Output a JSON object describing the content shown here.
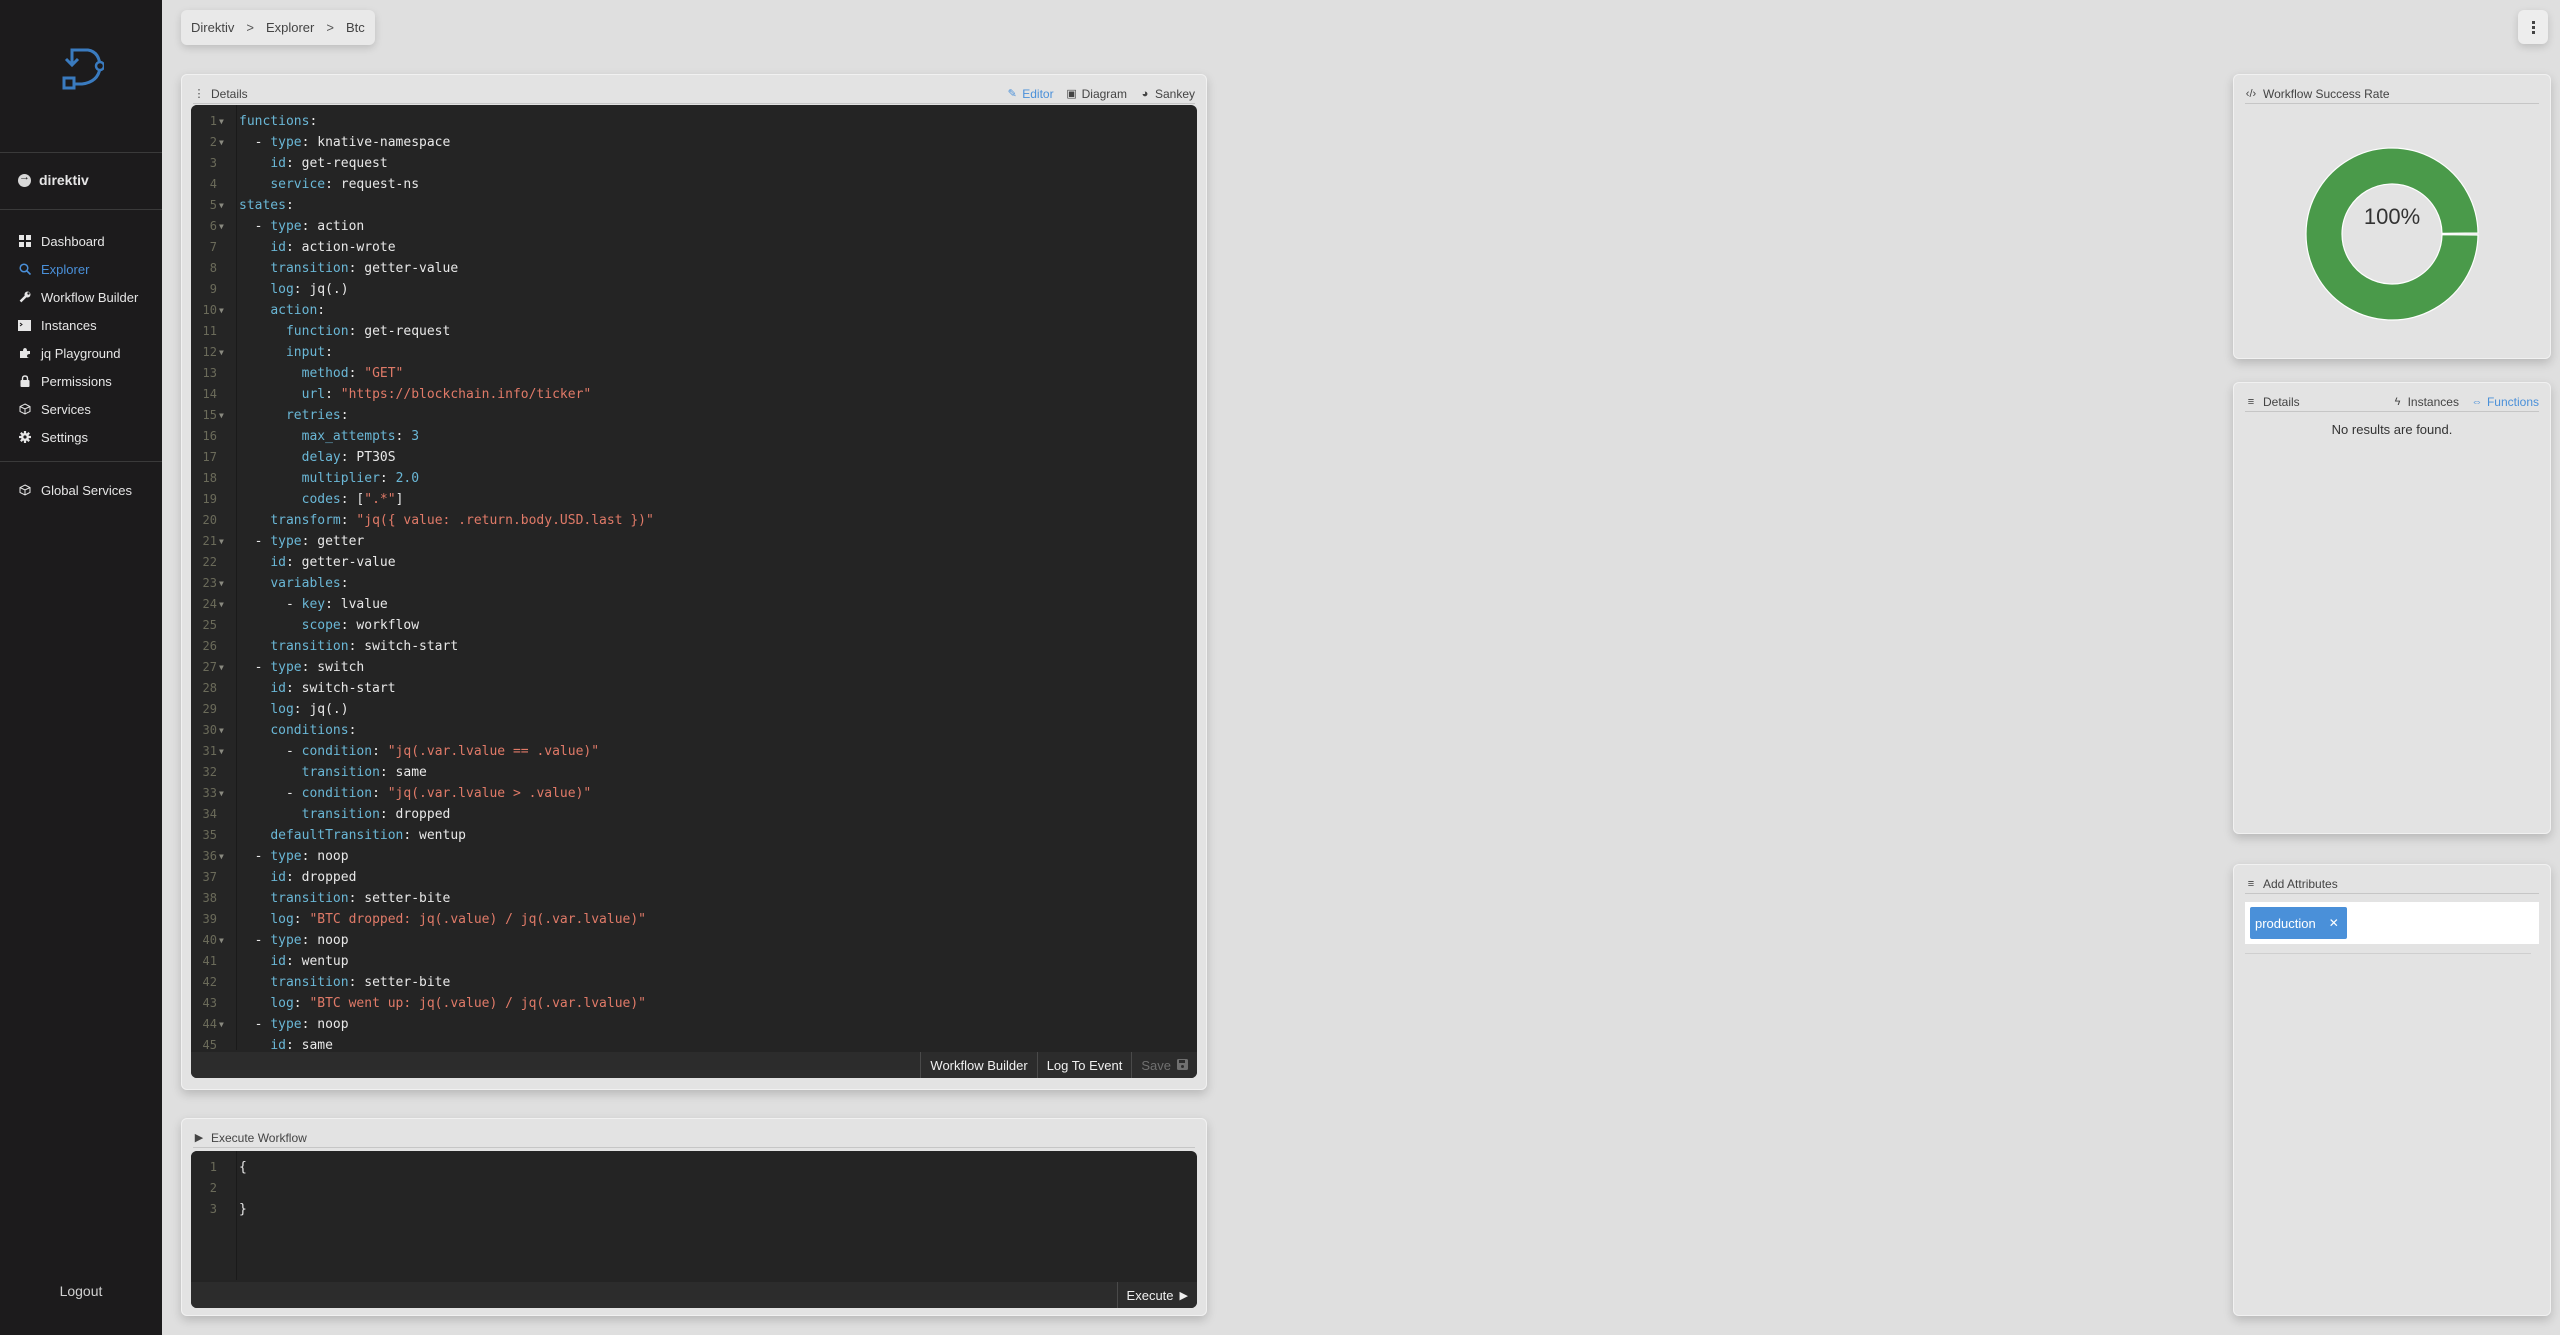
{
  "sidebar": {
    "namespace": "direktiv",
    "nav": [
      {
        "label": "Dashboard",
        "icon": "dashboard-icon",
        "active": false
      },
      {
        "label": "Explorer",
        "icon": "search-icon",
        "active": true
      },
      {
        "label": "Workflow Builder",
        "icon": "wrench-icon",
        "active": false
      },
      {
        "label": "Instances",
        "icon": "terminal-icon",
        "active": false
      },
      {
        "label": "jq Playground",
        "icon": "puzzle-icon",
        "active": false
      },
      {
        "label": "Permissions",
        "icon": "lock-icon",
        "active": false
      },
      {
        "label": "Services",
        "icon": "cube-icon",
        "active": false
      },
      {
        "label": "Settings",
        "icon": "gear-icon",
        "active": false
      }
    ],
    "global": {
      "label": "Global Services",
      "icon": "cube-icon"
    },
    "logout": "Logout"
  },
  "breadcrumb": {
    "items": [
      "Direktiv",
      "Explorer",
      "Btc"
    ],
    "separator": ">"
  },
  "details_card": {
    "title": "Details",
    "tabs": [
      {
        "label": "Editor",
        "icon": "pencil-icon",
        "active": true
      },
      {
        "label": "Diagram",
        "icon": "image-icon",
        "active": false
      },
      {
        "label": "Sankey",
        "icon": "pie-icon",
        "active": false
      }
    ],
    "code": [
      [
        [
          "k",
          "functions"
        ],
        [
          "p",
          ":"
        ]
      ],
      [
        [
          "p",
          "  - "
        ],
        [
          "k",
          "type"
        ],
        [
          "p",
          ": knative-namespace"
        ]
      ],
      [
        [
          "p",
          "    "
        ],
        [
          "k",
          "id"
        ],
        [
          "p",
          ": get-request"
        ]
      ],
      [
        [
          "p",
          "    "
        ],
        [
          "k",
          "service"
        ],
        [
          "p",
          ": request-ns"
        ]
      ],
      [
        [
          "k",
          "states"
        ],
        [
          "p",
          ":"
        ]
      ],
      [
        [
          "p",
          "  - "
        ],
        [
          "k",
          "type"
        ],
        [
          "p",
          ": action"
        ]
      ],
      [
        [
          "p",
          "    "
        ],
        [
          "k",
          "id"
        ],
        [
          "p",
          ": action-wrote"
        ]
      ],
      [
        [
          "p",
          "    "
        ],
        [
          "k",
          "transition"
        ],
        [
          "p",
          ": getter-value"
        ]
      ],
      [
        [
          "p",
          "    "
        ],
        [
          "k",
          "log"
        ],
        [
          "p",
          ": jq(.)"
        ]
      ],
      [
        [
          "p",
          "    "
        ],
        [
          "k",
          "action"
        ],
        [
          "p",
          ":"
        ]
      ],
      [
        [
          "p",
          "      "
        ],
        [
          "k",
          "function"
        ],
        [
          "p",
          ": get-request"
        ]
      ],
      [
        [
          "p",
          "      "
        ],
        [
          "k",
          "input"
        ],
        [
          "p",
          ":"
        ]
      ],
      [
        [
          "p",
          "        "
        ],
        [
          "k",
          "method"
        ],
        [
          "p",
          ": "
        ],
        [
          "s",
          "\"GET\""
        ]
      ],
      [
        [
          "p",
          "        "
        ],
        [
          "k",
          "url"
        ],
        [
          "p",
          ": "
        ],
        [
          "s",
          "\"https://blockchain.info/ticker\""
        ]
      ],
      [
        [
          "p",
          "      "
        ],
        [
          "k",
          "retries"
        ],
        [
          "p",
          ":"
        ]
      ],
      [
        [
          "p",
          "        "
        ],
        [
          "k",
          "max_attempts"
        ],
        [
          "p",
          ": "
        ],
        [
          "n",
          "3"
        ]
      ],
      [
        [
          "p",
          "        "
        ],
        [
          "k",
          "delay"
        ],
        [
          "p",
          ": PT30S"
        ]
      ],
      [
        [
          "p",
          "        "
        ],
        [
          "k",
          "multiplier"
        ],
        [
          "p",
          ": "
        ],
        [
          "n",
          "2.0"
        ]
      ],
      [
        [
          "p",
          "        "
        ],
        [
          "k",
          "codes"
        ],
        [
          "p",
          ": ["
        ],
        [
          "s",
          "\".*\""
        ],
        [
          "p",
          "]"
        ]
      ],
      [
        [
          "p",
          "    "
        ],
        [
          "k",
          "transform"
        ],
        [
          "p",
          ": "
        ],
        [
          "s",
          "\"jq({ value: .return.body.USD.last })\""
        ]
      ],
      [
        [
          "p",
          "  - "
        ],
        [
          "k",
          "type"
        ],
        [
          "p",
          ": getter"
        ]
      ],
      [
        [
          "p",
          "    "
        ],
        [
          "k",
          "id"
        ],
        [
          "p",
          ": getter-value"
        ]
      ],
      [
        [
          "p",
          "    "
        ],
        [
          "k",
          "variables"
        ],
        [
          "p",
          ":"
        ]
      ],
      [
        [
          "p",
          "      - "
        ],
        [
          "k",
          "key"
        ],
        [
          "p",
          ": lvalue"
        ]
      ],
      [
        [
          "p",
          "        "
        ],
        [
          "k",
          "scope"
        ],
        [
          "p",
          ": workflow"
        ]
      ],
      [
        [
          "p",
          "    "
        ],
        [
          "k",
          "transition"
        ],
        [
          "p",
          ": switch-start"
        ]
      ],
      [
        [
          "p",
          "  - "
        ],
        [
          "k",
          "type"
        ],
        [
          "p",
          ": switch"
        ]
      ],
      [
        [
          "p",
          "    "
        ],
        [
          "k",
          "id"
        ],
        [
          "p",
          ": switch-start"
        ]
      ],
      [
        [
          "p",
          "    "
        ],
        [
          "k",
          "log"
        ],
        [
          "p",
          ": jq(.)"
        ]
      ],
      [
        [
          "p",
          "    "
        ],
        [
          "k",
          "conditions"
        ],
        [
          "p",
          ":"
        ]
      ],
      [
        [
          "p",
          "      - "
        ],
        [
          "k",
          "condition"
        ],
        [
          "p",
          ": "
        ],
        [
          "s",
          "\"jq(.var.lvalue == .value)\""
        ]
      ],
      [
        [
          "p",
          "        "
        ],
        [
          "k",
          "transition"
        ],
        [
          "p",
          ": same"
        ]
      ],
      [
        [
          "p",
          "      - "
        ],
        [
          "k",
          "condition"
        ],
        [
          "p",
          ": "
        ],
        [
          "s",
          "\"jq(.var.lvalue > .value)\""
        ]
      ],
      [
        [
          "p",
          "        "
        ],
        [
          "k",
          "transition"
        ],
        [
          "p",
          ": dropped"
        ]
      ],
      [
        [
          "p",
          "    "
        ],
        [
          "k",
          "defaultTransition"
        ],
        [
          "p",
          ": wentup"
        ]
      ],
      [
        [
          "p",
          "  - "
        ],
        [
          "k",
          "type"
        ],
        [
          "p",
          ": noop"
        ]
      ],
      [
        [
          "p",
          "    "
        ],
        [
          "k",
          "id"
        ],
        [
          "p",
          ": dropped"
        ]
      ],
      [
        [
          "p",
          "    "
        ],
        [
          "k",
          "transition"
        ],
        [
          "p",
          ": setter-bite"
        ]
      ],
      [
        [
          "p",
          "    "
        ],
        [
          "k",
          "log"
        ],
        [
          "p",
          ": "
        ],
        [
          "s",
          "\"BTC dropped: jq(.value) / jq(.var.lvalue)\""
        ]
      ],
      [
        [
          "p",
          "  - "
        ],
        [
          "k",
          "type"
        ],
        [
          "p",
          ": noop"
        ]
      ],
      [
        [
          "p",
          "    "
        ],
        [
          "k",
          "id"
        ],
        [
          "p",
          ": wentup"
        ]
      ],
      [
        [
          "p",
          "    "
        ],
        [
          "k",
          "transition"
        ],
        [
          "p",
          ": setter-bite"
        ]
      ],
      [
        [
          "p",
          "    "
        ],
        [
          "k",
          "log"
        ],
        [
          "p",
          ": "
        ],
        [
          "s",
          "\"BTC went up: jq(.value) / jq(.var.lvalue)\""
        ]
      ],
      [
        [
          "p",
          "  - "
        ],
        [
          "k",
          "type"
        ],
        [
          "p",
          ": noop"
        ]
      ],
      [
        [
          "p",
          "    "
        ],
        [
          "k",
          "id"
        ],
        [
          "p",
          ": same"
        ]
      ]
    ],
    "foldable_lines": [
      1,
      2,
      5,
      6,
      10,
      12,
      15,
      21,
      23,
      24,
      27,
      30,
      31,
      33,
      36,
      40,
      44
    ],
    "footer_buttons": [
      {
        "label": "Workflow Builder",
        "disabled": false
      },
      {
        "label": "Log To Event",
        "disabled": false
      },
      {
        "label": "Save",
        "disabled": true,
        "icon": "save-icon"
      }
    ]
  },
  "execute_card": {
    "title": "Execute Workflow",
    "code": [
      "{",
      "",
      "}"
    ],
    "execute_label": "Execute"
  },
  "success_card": {
    "title": "Workflow Success Rate",
    "rate_label": "100%",
    "success_percent": 100,
    "color": "#4a9a4a"
  },
  "functions_card": {
    "title": "Details",
    "tabs": [
      {
        "label": "Instances",
        "icon": "bolt-icon",
        "active": false
      },
      {
        "label": "Functions",
        "icon": "arrows-icon",
        "active": true
      }
    ],
    "empty_text": "No results are found."
  },
  "attributes_card": {
    "title": "Add Attributes",
    "tags": [
      "production"
    ],
    "tag_color": "#4a90d9"
  },
  "colors": {
    "accent": "#4a90d9",
    "sidebar_bg": "#1c1b1c",
    "editor_bg": "#242424",
    "yaml_key": "#6ab7d6",
    "yaml_string": "#e07a68"
  }
}
